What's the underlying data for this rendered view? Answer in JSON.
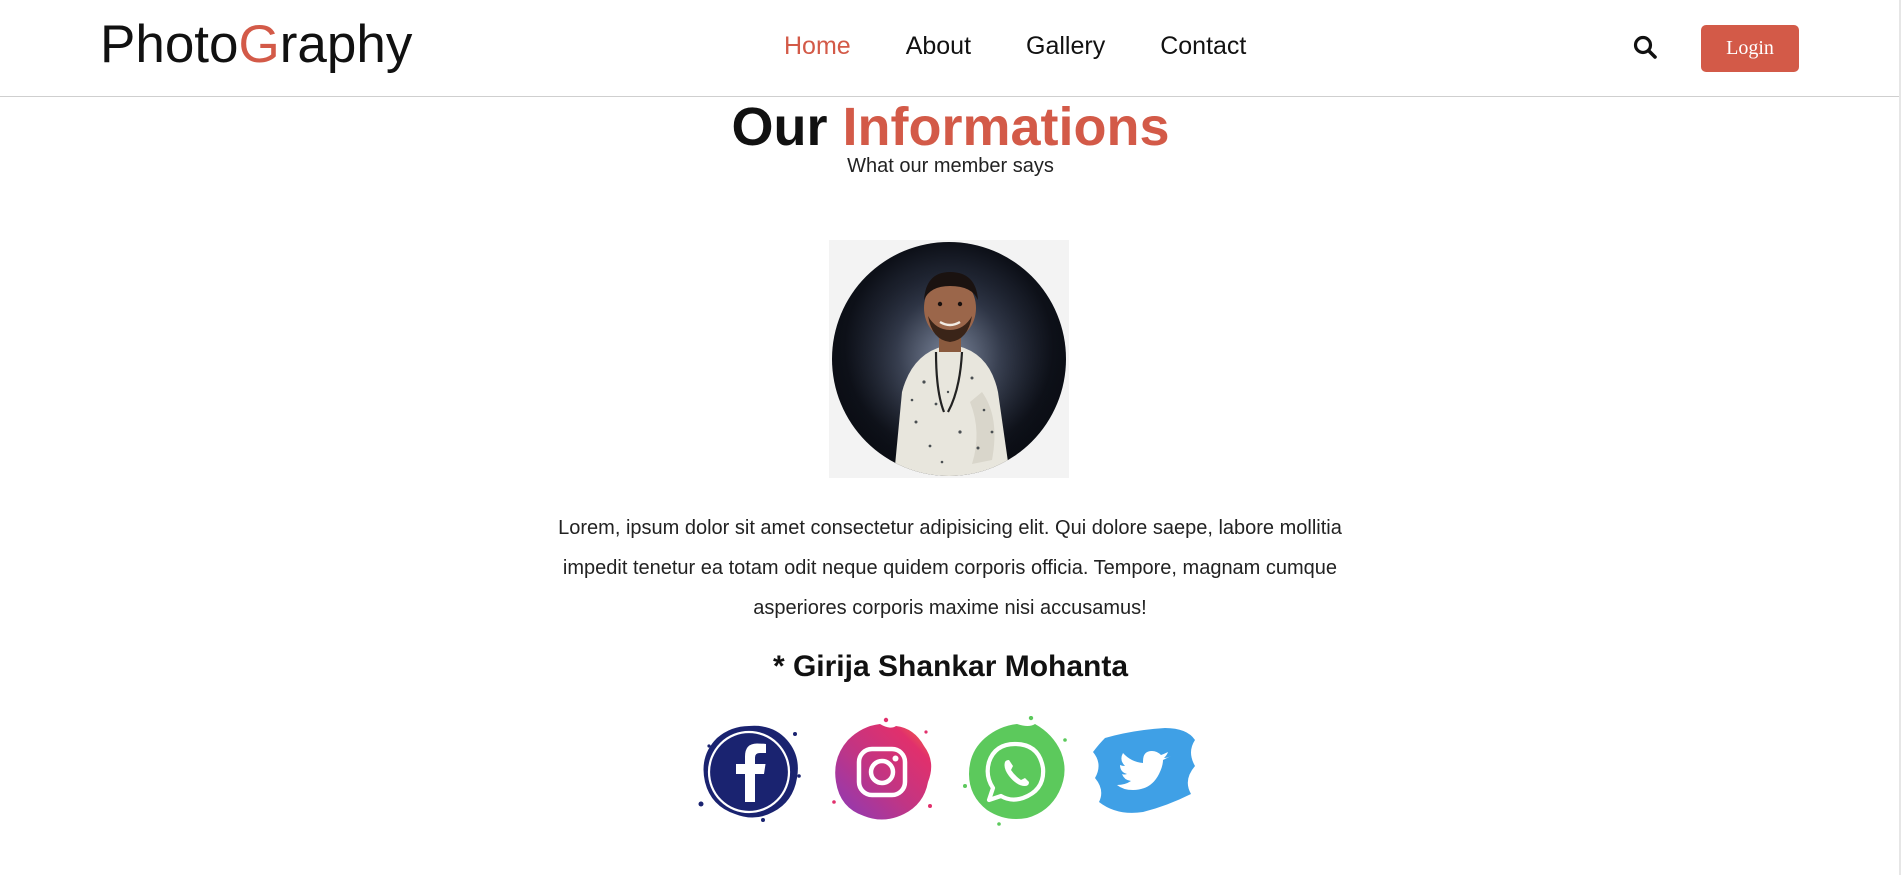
{
  "header": {
    "logo_part1": "Photo",
    "logo_accent": "G",
    "logo_part2": "raphy",
    "nav": [
      {
        "label": "Home",
        "active": true
      },
      {
        "label": "About",
        "active": false
      },
      {
        "label": "Gallery",
        "active": false
      },
      {
        "label": "Contact",
        "active": false
      }
    ],
    "search_icon": "search-icon",
    "login_label": "Login"
  },
  "section": {
    "title_part1": "Our",
    "title_accent": "Informations",
    "subtitle": "What our member says"
  },
  "testimonial": {
    "photo": "member-portrait",
    "quote": "Lorem, ipsum dolor sit amet consectetur adipisicing elit. Qui dolore saepe, labore mollitia impedit tenetur ea totam odit neque quidem corporis officia. Tempore, magnam cumque asperiores corporis maxime nisi accusamus!",
    "author": "* Girija Shankar Mohanta"
  },
  "socials": [
    {
      "icon": "facebook-icon"
    },
    {
      "icon": "instagram-icon"
    },
    {
      "icon": "whatsapp-icon"
    },
    {
      "icon": "twitter-icon"
    }
  ],
  "colors": {
    "accent": "#d35a48",
    "text": "#111111",
    "facebook": "#1a2370",
    "instagram": "#c13584",
    "whatsapp": "#5cc95c",
    "twitter": "#3fa0e6"
  }
}
